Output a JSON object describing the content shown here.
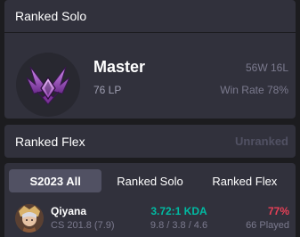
{
  "solo": {
    "title": "Ranked Solo",
    "tier": "Master",
    "lp": "76 LP",
    "record": "56W 16L",
    "win_rate": "Win Rate 78%",
    "emblem_icon": "master-emblem-icon"
  },
  "flex": {
    "title": "Ranked Flex",
    "status": "Unranked"
  },
  "tabs": [
    {
      "label": "S2023 All",
      "active": true
    },
    {
      "label": "Ranked Solo",
      "active": false
    },
    {
      "label": "Ranked Flex",
      "active": false
    }
  ],
  "champions": [
    {
      "name": "Qiyana",
      "cs": "CS 201.8 (7.9)",
      "kda": "3.72:1 KDA",
      "kda_detail": "9.8 / 3.8 / 4.6",
      "win_rate": "77%",
      "played": "66 Played"
    }
  ],
  "colors": {
    "background": "#1c1c1f",
    "card": "#31313c",
    "kda": "#00bba3",
    "win_rate_high": "#e84057",
    "muted": "#7b7a8e"
  }
}
